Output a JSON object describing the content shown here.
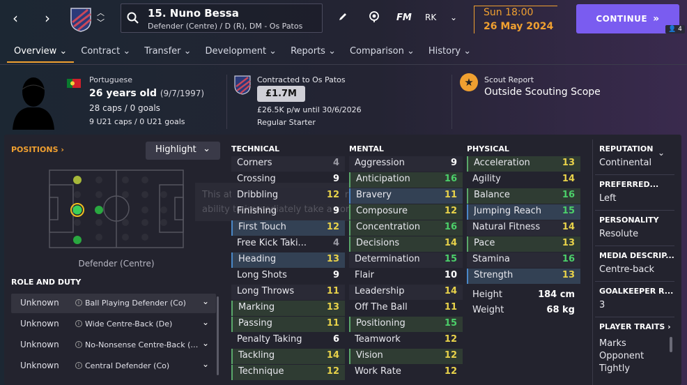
{
  "header": {
    "player_name": "15. Nuno Bessa",
    "player_sub": "Defender (Centre) / D (R), DM - Os Patos",
    "fm_label": "FM",
    "rk_label": "RK",
    "date_time": "Sun 18:00",
    "date": "26 May 2024",
    "continue_label": "CONTINUE",
    "continue_badge": "4"
  },
  "tabs": [
    {
      "label": "Overview"
    },
    {
      "label": "Contract"
    },
    {
      "label": "Transfer"
    },
    {
      "label": "Development"
    },
    {
      "label": "Reports"
    },
    {
      "label": "Comparison"
    },
    {
      "label": "History"
    }
  ],
  "info": {
    "nationality": "Portuguese",
    "age": "26 years old",
    "dob": "(9/7/1997)",
    "caps": "28 caps / 0 goals",
    "u21": "9 U21 caps / 0 U21 goals",
    "contracted": "Contracted to Os Patos",
    "value": "£1.7M",
    "wage": "£26.5K p/w until 30/6/2026",
    "squad_status": "Regular Starter",
    "scout_label": "Scout Report",
    "scout_value": "Outside Scouting Scope"
  },
  "positions": {
    "link": "POSITIONS",
    "highlight": "Highlight",
    "label": "Defender (Centre)"
  },
  "roles": {
    "heading": "ROLE AND DUTY",
    "rows": [
      {
        "ability": "Unknown",
        "role": "Ball Playing Defender (Co)"
      },
      {
        "ability": "Unknown",
        "role": "Wide Centre-Back (De)"
      },
      {
        "ability": "Unknown",
        "role": "No-Nonsense Centre-Back (…"
      },
      {
        "ability": "Unknown",
        "role": "Central Defender (Co)"
      }
    ]
  },
  "overlay_text": "This attribute reflects the player's ability to immediately take a corner",
  "technical": {
    "heading": "TECHNICAL",
    "rows": [
      {
        "name": "Corners",
        "value": "4"
      },
      {
        "name": "Crossing",
        "value": "9"
      },
      {
        "name": "Dribbling",
        "value": "12"
      },
      {
        "name": "Finishing",
        "value": "9"
      },
      {
        "name": "First Touch",
        "value": "12"
      },
      {
        "name": "Free Kick Taki...",
        "value": "4"
      },
      {
        "name": "Heading",
        "value": "13"
      },
      {
        "name": "Long Shots",
        "value": "9"
      },
      {
        "name": "Long Throws",
        "value": "11"
      },
      {
        "name": "Marking",
        "value": "13"
      },
      {
        "name": "Passing",
        "value": "11"
      },
      {
        "name": "Penalty Taking",
        "value": "6"
      },
      {
        "name": "Tackling",
        "value": "14"
      },
      {
        "name": "Technique",
        "value": "12"
      }
    ]
  },
  "mental": {
    "heading": "MENTAL",
    "rows": [
      {
        "name": "Aggression",
        "value": "9"
      },
      {
        "name": "Anticipation",
        "value": "16"
      },
      {
        "name": "Bravery",
        "value": "11"
      },
      {
        "name": "Composure",
        "value": "12"
      },
      {
        "name": "Concentration",
        "value": "16"
      },
      {
        "name": "Decisions",
        "value": "14"
      },
      {
        "name": "Determination",
        "value": "15"
      },
      {
        "name": "Flair",
        "value": "10"
      },
      {
        "name": "Leadership",
        "value": "14"
      },
      {
        "name": "Off The Ball",
        "value": "11"
      },
      {
        "name": "Positioning",
        "value": "15"
      },
      {
        "name": "Teamwork",
        "value": "12"
      },
      {
        "name": "Vision",
        "value": "12"
      },
      {
        "name": "Work Rate",
        "value": "12"
      }
    ]
  },
  "physical": {
    "heading": "PHYSICAL",
    "rows": [
      {
        "name": "Acceleration",
        "value": "13"
      },
      {
        "name": "Agility",
        "value": "14"
      },
      {
        "name": "Balance",
        "value": "16"
      },
      {
        "name": "Jumping Reach",
        "value": "15"
      },
      {
        "name": "Natural Fitness",
        "value": "14"
      },
      {
        "name": "Pace",
        "value": "13"
      },
      {
        "name": "Stamina",
        "value": "16"
      },
      {
        "name": "Strength",
        "value": "13"
      }
    ],
    "height_label": "Height",
    "height_value": "184 cm",
    "weight_label": "Weight",
    "weight_value": "68 kg"
  },
  "side": {
    "reputation_h": "REPUTATION",
    "reputation_v": "Continental",
    "preferred_h": "PREFERRED...",
    "preferred_v": "Left",
    "personality_h": "PERSONALITY",
    "personality_v": "Resolute",
    "media_h": "MEDIA DESCRIP...",
    "media_v": "Centre-back",
    "gk_h": "GOALKEEPER R...",
    "gk_v": "3",
    "traits_h": "PLAYER TRAITS",
    "traits_v1": "Marks",
    "traits_v2": "Opponent",
    "traits_v3": "Tightly"
  },
  "colors": {
    "accent": "#f0a030",
    "continue": "#7a5cf0",
    "value_yellow": "#e8d24a",
    "value_green": "#4cd06a",
    "value_white": "#ffffff",
    "value_grey": "#9a9aa4"
  }
}
